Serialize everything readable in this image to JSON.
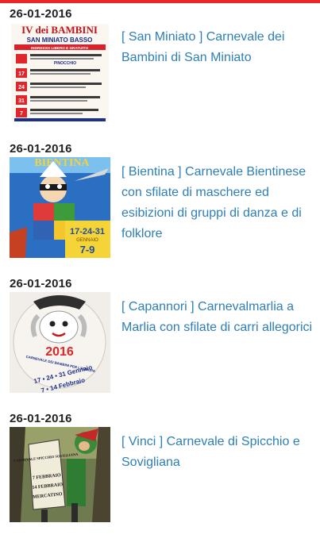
{
  "feed": {
    "entries": [
      {
        "date": "26-01-2016",
        "title": "[ San Miniato ] Carnevale dei Bambini di San Miniato",
        "poster_text": [
          "IV dei BAMBINI",
          "SAN MINIATO BASSO",
          "INGRESSO LIBERO E GRATUITO",
          "PINOCCHIO",
          "17",
          "24",
          "31",
          "7"
        ]
      },
      {
        "date": "26-01-2016",
        "title": "[ Bientina ] Carnevale Bientinese con sfilate di maschere ed esibizioni di gruppi di danza e di folklore",
        "poster_text": [
          "BIENTINA",
          "17-24-31",
          "GENNAIO",
          "7-9"
        ]
      },
      {
        "date": "26-01-2016",
        "title": "[ Capannori ] Carnevalmarlia a Marlia con sfilate di carri allegorici",
        "poster_text": [
          "2016",
          "CARNEVALE DEI BAMBINI PER L'EUROPA",
          "17 • 24 • 31 Gennaio",
          "7 • 14 Febbraio"
        ]
      },
      {
        "date": "26-01-2016",
        "title": "[ Vinci ] Carnevale di Spicchio e Sovigliana",
        "poster_text": [
          "CARNEVALE SPICCHIO SOVIGLIANA",
          "7 FEBBRAIO",
          "14 FEBBRAIO",
          "MERCATINO"
        ]
      }
    ]
  },
  "colors": {
    "accent": "#e8262b",
    "link": "#2d7fb6",
    "date": "#222222"
  }
}
